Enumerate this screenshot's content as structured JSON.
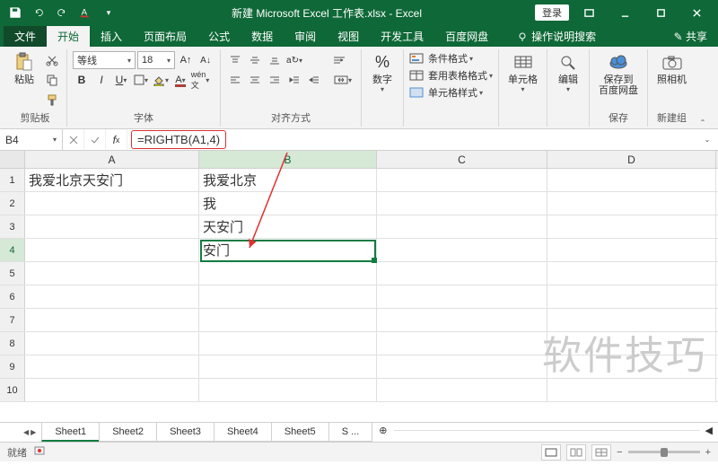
{
  "titlebar": {
    "title": "新建 Microsoft Excel 工作表.xlsx - Excel",
    "login": "登录"
  },
  "tabs": {
    "file": "文件",
    "home": "开始",
    "insert": "插入",
    "layout": "页面布局",
    "formula": "公式",
    "data": "数据",
    "review": "审阅",
    "view": "视图",
    "dev": "开发工具",
    "baidu": "百度网盘",
    "search": "操作说明搜索",
    "share": "共享"
  },
  "ribbon": {
    "clipboard": {
      "paste": "粘贴",
      "label": "剪贴板"
    },
    "font": {
      "name": "等线",
      "size": "18",
      "label": "字体"
    },
    "align": {
      "label": "对齐方式"
    },
    "number": {
      "btn": "数字",
      "label": ""
    },
    "styles": {
      "cond": "条件格式",
      "table": "套用表格格式",
      "cell": "单元格样式",
      "label": ""
    },
    "cells": {
      "btn": "单元格",
      "label": ""
    },
    "editing": {
      "btn": "编辑",
      "label": ""
    },
    "save": {
      "btn": "保存到\n百度网盘",
      "label": "保存"
    },
    "camera": {
      "btn": "照相机",
      "label": "新建组"
    }
  },
  "formula_bar": {
    "name": "B4",
    "formula": "=RIGHTB(A1,4)"
  },
  "columns": [
    "A",
    "B",
    "C",
    "D"
  ],
  "rows": [
    1,
    2,
    3,
    4,
    5,
    6,
    7,
    8,
    9,
    10
  ],
  "cells": {
    "A1": "我爱北京天安门",
    "B1": "我爱北京",
    "B2": "我",
    "B3": "天安门",
    "B4": "安门"
  },
  "active": {
    "col": "B",
    "row": 4
  },
  "sheets": {
    "list": [
      "Sheet1",
      "Sheet2",
      "Sheet3",
      "Sheet4",
      "Sheet5"
    ],
    "more": "S ...",
    "active": 0
  },
  "statusbar": {
    "ready": "就绪"
  },
  "watermark": "软件技巧"
}
